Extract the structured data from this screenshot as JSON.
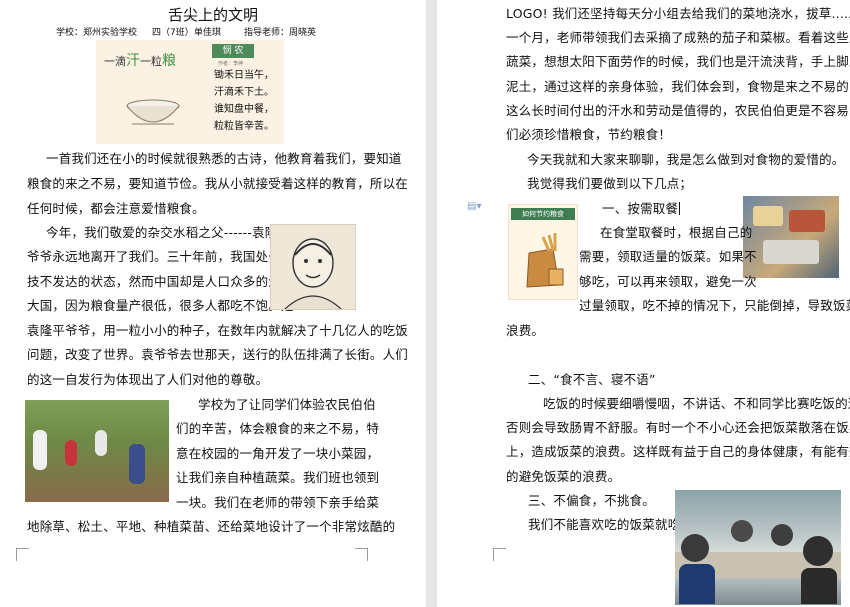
{
  "left_page": {
    "title": "舌尖上的文明",
    "school": "学校：郑州实验学校",
    "class": "四（7班）",
    "author": "单佳琪",
    "teacher": "指导老师：周晓英",
    "poster": {
      "tag": "悯 农",
      "author_small": "作者：李绅",
      "heading_left": "一滴",
      "heading_han": "汗",
      "heading_mid": "一粒",
      "heading_liang": "粮",
      "poem": [
        "锄禾日当午，",
        "汗滴禾下土。",
        "谁知盘中餐，",
        "粒粒皆辛苦。"
      ]
    },
    "paragraphs": [
      "一首我们还在小的时候就很熟悉的古诗，他教育着我们，要知道",
      "粮食的来之不易，要知道节俭。我从小就接受着这样的教育，所以在",
      "任何时候，都会注意爱惜粮食。",
      "今年，我们敬爱的杂交水稻之父------袁隆平",
      "爷爷永远地离开了我们。三十年前，我国处于科",
      "技不发达的状态，然而中国却是人口众多的泱泱",
      "大国，因为粮食量产很低，很多人都吃不饱。是",
      "袁隆平爷爷，用一粒小小的种子，在数年内就解决了十几亿人的吃饭",
      "问题，改变了世界。袁爷爷去世那天，送行的队伍排满了长街。人们",
      "的这一自发行为体现出了人们对他的尊敬。",
      "学校为了让同学们体验农民伯伯",
      "们的辛苦，体会粮食的来之不易，特",
      "意在校园的一角开发了一块小菜园，",
      "让我们亲自种植蔬菜。我们班也领到",
      "一块。我们在老师的带领下亲手给菜",
      "地除草、松土、平地、种植菜苗、还给菜地设计了一个非常炫酷的"
    ]
  },
  "right_page": {
    "paragraphs": [
      "LOGO! 我们还坚持每天分小组去给我们的菜地浇水，拔草......过了",
      "一个月，老师带领我们去采摘了成熟的茄子和菜椒。看着这些成熟的",
      "蔬菜，想想太阳下面劳作的时候，我们也是汗流浃背，手上脚上全是",
      "泥土，通过这样的亲身体验，我们体会到，食物是来之不易的，我们",
      "这么长时间付出的汗水和劳动是值得的，农民伯伯更是不容易的。我",
      "们必须珍惜粮食，节约粮食！",
      "今天我就和大家来聊聊，我是怎么做到对食物的爱惜的。",
      "我觉得我们要做到以下几点；",
      "一、按需取餐",
      "在食堂取餐时，根据自己的",
      "需要，领取适量的饭菜。如果不",
      "够吃，可以再来领取，避免一次",
      "过量领取，吃不掉的情况下，只能倒掉，导致饭菜的",
      "浪费。",
      "二、“食不言、寝不语”",
      "吃饭的时候要细嚼慢咽，不讲话、不和同学比赛吃饭的速度，",
      "否则会导致肠胃不舒服。有时一个不小心还会把饭菜散落在饭桌",
      "上，造成饭菜的浪费。这样既有益于自己的身体健康，有能有效",
      "的避免饭菜的浪费。",
      "三、不偏食，不挑食。",
      "我们不能喜欢吃的饭菜就吃"
    ],
    "sticker_tag": "如何节约粮食"
  }
}
